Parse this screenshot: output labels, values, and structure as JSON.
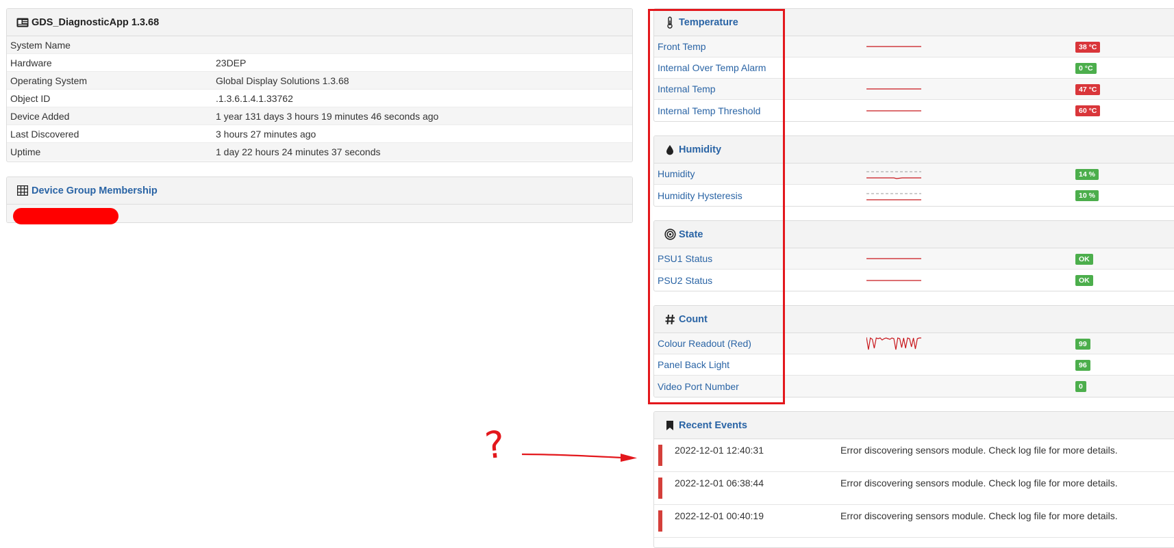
{
  "overview": {
    "title": "GDS_DiagnosticApp 1.3.68",
    "rows": [
      {
        "label": "System Name",
        "value": ""
      },
      {
        "label": "Hardware",
        "value": "23DEP"
      },
      {
        "label": "Operating System",
        "value": "Global Display Solutions 1.3.68"
      },
      {
        "label": "Object ID",
        "value": ".1.3.6.1.4.1.33762"
      },
      {
        "label": "Device Added",
        "value": "1 year 131 days 3 hours 19 minutes 46 seconds ago"
      },
      {
        "label": "Last Discovered",
        "value": "3 hours 27 minutes ago"
      },
      {
        "label": "Uptime",
        "value": "1 day 22 hours 24 minutes 37 seconds"
      }
    ]
  },
  "group_membership": {
    "title": "Device Group Membership"
  },
  "sensors": {
    "temperature": {
      "title": "Temperature",
      "items": [
        {
          "name": "Front Temp",
          "value": "38 °C",
          "status": "red"
        },
        {
          "name": "Internal Over Temp Alarm",
          "value": "0 °C",
          "status": "green"
        },
        {
          "name": "Internal Temp",
          "value": "47 °C",
          "status": "red"
        },
        {
          "name": "Internal Temp Threshold",
          "value": "60 °C",
          "status": "red"
        }
      ]
    },
    "humidity": {
      "title": "Humidity",
      "items": [
        {
          "name": "Humidity",
          "value": "14 %",
          "status": "green"
        },
        {
          "name": "Humidity Hysteresis",
          "value": "10 %",
          "status": "green"
        }
      ]
    },
    "state": {
      "title": "State",
      "items": [
        {
          "name": "PSU1 Status",
          "value": "OK",
          "status": "green"
        },
        {
          "name": "PSU2 Status",
          "value": "OK",
          "status": "green"
        }
      ]
    },
    "count": {
      "title": "Count",
      "items": [
        {
          "name": "Colour Readout (Red)",
          "value": "99",
          "status": "green"
        },
        {
          "name": "Panel Back Light",
          "value": "96",
          "status": "green"
        },
        {
          "name": "Video Port Number",
          "value": "0",
          "status": "green"
        }
      ]
    }
  },
  "events": {
    "title": "Recent Events",
    "items": [
      {
        "time": "2022-12-01 12:40:31",
        "message": "Error discovering sensors module. Check log file for more details."
      },
      {
        "time": "2022-12-01 06:38:44",
        "message": "Error discovering sensors module. Check log file for more details."
      },
      {
        "time": "2022-12-01 00:40:19",
        "message": "Error discovering sensors module. Check log file for more details."
      }
    ]
  },
  "annotation": {
    "question_mark": "?"
  },
  "colors": {
    "link": "#2a64a5",
    "badge_red": "#d9363a",
    "badge_green": "#4cae4c",
    "annotation_red": "#e3171c"
  }
}
